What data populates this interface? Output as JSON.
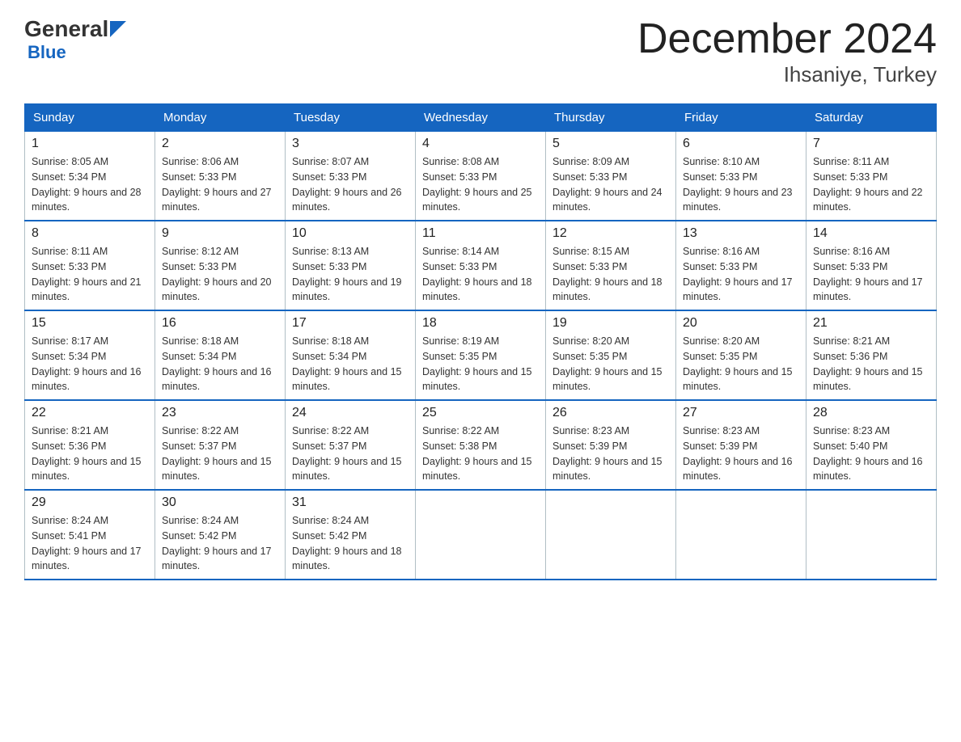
{
  "logo": {
    "general": "General",
    "blue": "Blue"
  },
  "title": "December 2024",
  "subtitle": "Ihsaniye, Turkey",
  "days_of_week": [
    "Sunday",
    "Monday",
    "Tuesday",
    "Wednesday",
    "Thursday",
    "Friday",
    "Saturday"
  ],
  "weeks": [
    [
      {
        "day": "1",
        "sunrise": "8:05 AM",
        "sunset": "5:34 PM",
        "daylight": "9 hours and 28 minutes."
      },
      {
        "day": "2",
        "sunrise": "8:06 AM",
        "sunset": "5:33 PM",
        "daylight": "9 hours and 27 minutes."
      },
      {
        "day": "3",
        "sunrise": "8:07 AM",
        "sunset": "5:33 PM",
        "daylight": "9 hours and 26 minutes."
      },
      {
        "day": "4",
        "sunrise": "8:08 AM",
        "sunset": "5:33 PM",
        "daylight": "9 hours and 25 minutes."
      },
      {
        "day": "5",
        "sunrise": "8:09 AM",
        "sunset": "5:33 PM",
        "daylight": "9 hours and 24 minutes."
      },
      {
        "day": "6",
        "sunrise": "8:10 AM",
        "sunset": "5:33 PM",
        "daylight": "9 hours and 23 minutes."
      },
      {
        "day": "7",
        "sunrise": "8:11 AM",
        "sunset": "5:33 PM",
        "daylight": "9 hours and 22 minutes."
      }
    ],
    [
      {
        "day": "8",
        "sunrise": "8:11 AM",
        "sunset": "5:33 PM",
        "daylight": "9 hours and 21 minutes."
      },
      {
        "day": "9",
        "sunrise": "8:12 AM",
        "sunset": "5:33 PM",
        "daylight": "9 hours and 20 minutes."
      },
      {
        "day": "10",
        "sunrise": "8:13 AM",
        "sunset": "5:33 PM",
        "daylight": "9 hours and 19 minutes."
      },
      {
        "day": "11",
        "sunrise": "8:14 AM",
        "sunset": "5:33 PM",
        "daylight": "9 hours and 18 minutes."
      },
      {
        "day": "12",
        "sunrise": "8:15 AM",
        "sunset": "5:33 PM",
        "daylight": "9 hours and 18 minutes."
      },
      {
        "day": "13",
        "sunrise": "8:16 AM",
        "sunset": "5:33 PM",
        "daylight": "9 hours and 17 minutes."
      },
      {
        "day": "14",
        "sunrise": "8:16 AM",
        "sunset": "5:33 PM",
        "daylight": "9 hours and 17 minutes."
      }
    ],
    [
      {
        "day": "15",
        "sunrise": "8:17 AM",
        "sunset": "5:34 PM",
        "daylight": "9 hours and 16 minutes."
      },
      {
        "day": "16",
        "sunrise": "8:18 AM",
        "sunset": "5:34 PM",
        "daylight": "9 hours and 16 minutes."
      },
      {
        "day": "17",
        "sunrise": "8:18 AM",
        "sunset": "5:34 PM",
        "daylight": "9 hours and 15 minutes."
      },
      {
        "day": "18",
        "sunrise": "8:19 AM",
        "sunset": "5:35 PM",
        "daylight": "9 hours and 15 minutes."
      },
      {
        "day": "19",
        "sunrise": "8:20 AM",
        "sunset": "5:35 PM",
        "daylight": "9 hours and 15 minutes."
      },
      {
        "day": "20",
        "sunrise": "8:20 AM",
        "sunset": "5:35 PM",
        "daylight": "9 hours and 15 minutes."
      },
      {
        "day": "21",
        "sunrise": "8:21 AM",
        "sunset": "5:36 PM",
        "daylight": "9 hours and 15 minutes."
      }
    ],
    [
      {
        "day": "22",
        "sunrise": "8:21 AM",
        "sunset": "5:36 PM",
        "daylight": "9 hours and 15 minutes."
      },
      {
        "day": "23",
        "sunrise": "8:22 AM",
        "sunset": "5:37 PM",
        "daylight": "9 hours and 15 minutes."
      },
      {
        "day": "24",
        "sunrise": "8:22 AM",
        "sunset": "5:37 PM",
        "daylight": "9 hours and 15 minutes."
      },
      {
        "day": "25",
        "sunrise": "8:22 AM",
        "sunset": "5:38 PM",
        "daylight": "9 hours and 15 minutes."
      },
      {
        "day": "26",
        "sunrise": "8:23 AM",
        "sunset": "5:39 PM",
        "daylight": "9 hours and 15 minutes."
      },
      {
        "day": "27",
        "sunrise": "8:23 AM",
        "sunset": "5:39 PM",
        "daylight": "9 hours and 16 minutes."
      },
      {
        "day": "28",
        "sunrise": "8:23 AM",
        "sunset": "5:40 PM",
        "daylight": "9 hours and 16 minutes."
      }
    ],
    [
      {
        "day": "29",
        "sunrise": "8:24 AM",
        "sunset": "5:41 PM",
        "daylight": "9 hours and 17 minutes."
      },
      {
        "day": "30",
        "sunrise": "8:24 AM",
        "sunset": "5:42 PM",
        "daylight": "9 hours and 17 minutes."
      },
      {
        "day": "31",
        "sunrise": "8:24 AM",
        "sunset": "5:42 PM",
        "daylight": "9 hours and 18 minutes."
      },
      {
        "day": "",
        "sunrise": "",
        "sunset": "",
        "daylight": ""
      },
      {
        "day": "",
        "sunrise": "",
        "sunset": "",
        "daylight": ""
      },
      {
        "day": "",
        "sunrise": "",
        "sunset": "",
        "daylight": ""
      },
      {
        "day": "",
        "sunrise": "",
        "sunset": "",
        "daylight": ""
      }
    ]
  ]
}
